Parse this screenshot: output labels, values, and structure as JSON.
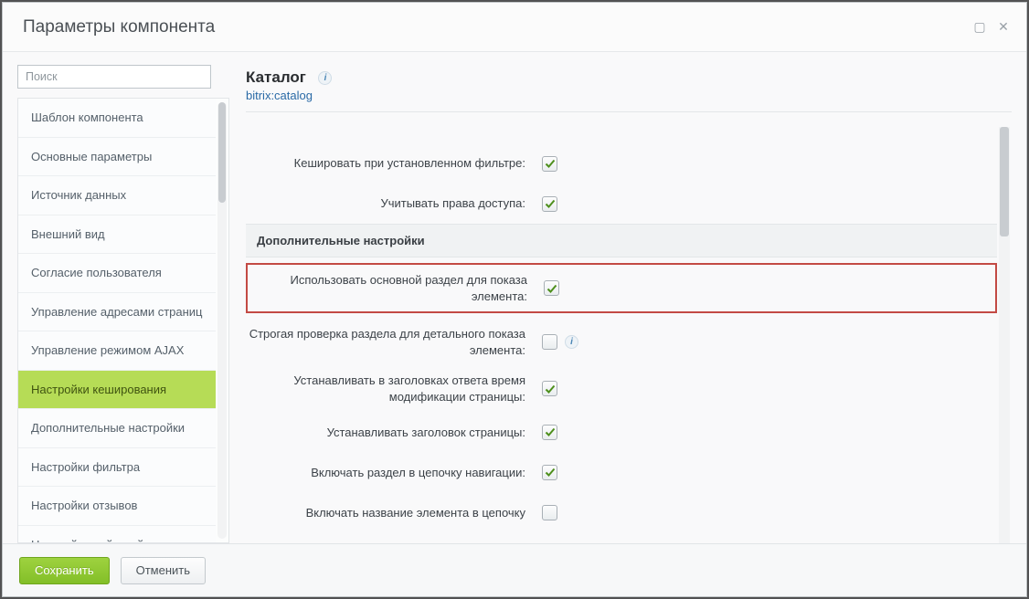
{
  "dialog": {
    "title": "Параметры компонента"
  },
  "search": {
    "placeholder": "Поиск"
  },
  "sidebar": {
    "items": [
      {
        "label": "Шаблон компонента"
      },
      {
        "label": "Основные параметры"
      },
      {
        "label": "Источник данных"
      },
      {
        "label": "Внешний вид"
      },
      {
        "label": "Согласие пользователя"
      },
      {
        "label": "Управление адресами страниц"
      },
      {
        "label": "Управление режимом AJAX"
      },
      {
        "label": "Настройки кеширования",
        "active": true
      },
      {
        "label": "Дополнительные настройки"
      },
      {
        "label": "Настройки фильтра"
      },
      {
        "label": "Настройки отзывов"
      },
      {
        "label": "Настройки действий"
      }
    ]
  },
  "component": {
    "title": "Каталог",
    "subtitle": "bitrix:catalog"
  },
  "sections": {
    "additional_title": "Дополнительные настройки"
  },
  "settings": {
    "cache_filter": {
      "label": "Кешировать при установленном фильтре:",
      "checked": true
    },
    "cache_groups": {
      "label": "Учитывать права доступа:",
      "checked": true
    },
    "use_main_section": {
      "label": "Использовать основной раздел для показа элемента:",
      "checked": true
    },
    "strict_section_check": {
      "label": "Строгая проверка раздела для детального показа элемента:",
      "checked": false,
      "info": true
    },
    "set_last_modified": {
      "label": "Устанавливать в заголовках ответа время модификации страницы:",
      "checked": true
    },
    "set_title": {
      "label": "Устанавливать заголовок страницы:",
      "checked": true
    },
    "add_section_chain": {
      "label": "Включать раздел в цепочку навигации:",
      "checked": true
    },
    "add_element_chain": {
      "label": "Включать название элемента в цепочку",
      "checked": false
    }
  },
  "footer": {
    "save": "Сохранить",
    "cancel": "Отменить"
  }
}
